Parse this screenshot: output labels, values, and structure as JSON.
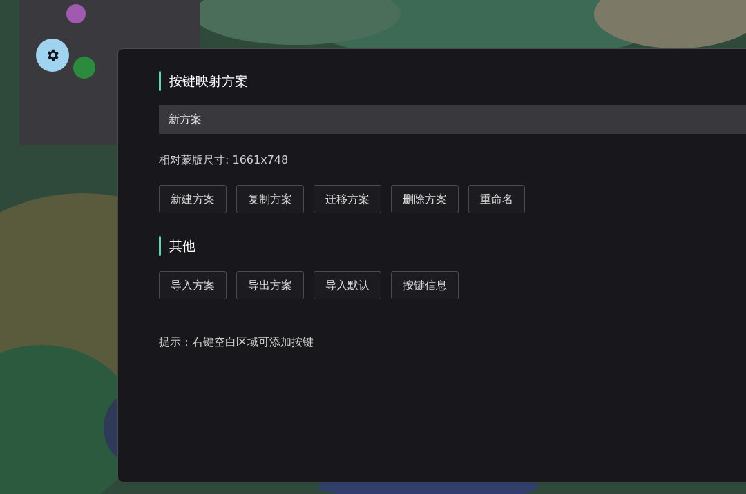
{
  "mapping": {
    "title": "按键映射方案",
    "scheme_field": {
      "value": "新方案"
    },
    "size_text": "相对蒙版尺寸: 1661x748",
    "buttons": [
      "新建方案",
      "复制方案",
      "迁移方案",
      "删除方案",
      "重命名"
    ]
  },
  "other": {
    "title": "其他",
    "buttons": [
      "导入方案",
      "导出方案",
      "导入默认",
      "按键信息"
    ]
  },
  "hint": "提示：右键空白区域可添加按键"
}
